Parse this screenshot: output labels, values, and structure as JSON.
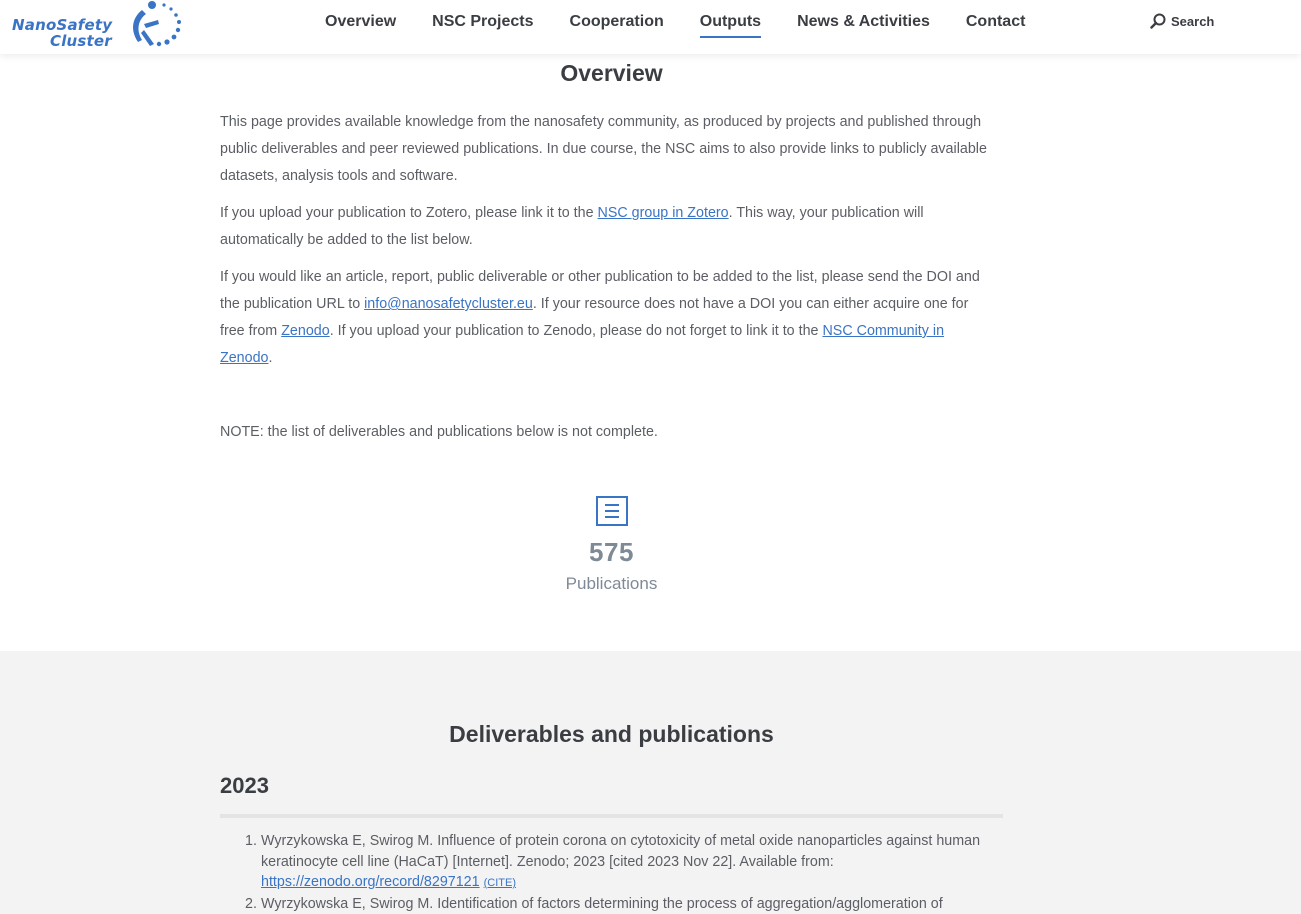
{
  "brand": {
    "line1": "NanoSafety",
    "line2": "Cluster",
    "color": "#3a74c4"
  },
  "nav": {
    "items": [
      "Overview",
      "NSC Projects",
      "Cooperation",
      "Outputs",
      "News & Activities",
      "Contact"
    ],
    "active": "Outputs"
  },
  "search": {
    "label": "Search",
    "icon": "search-icon"
  },
  "page": {
    "title": "Overview",
    "p1": "This page provides available knowledge from the nanosafety community, as produced by projects and published through public deliverables and peer reviewed publications. In due course, the NSC aims to also provide links to publicly available datasets, analysis tools and software.",
    "p2_before": "If you upload your publication to Zotero, please link it to the ",
    "p2_link": "NSC group in Zotero",
    "p2_after": ". This way, your publication will automatically be added to the list below.",
    "p3_a": "If you would like an article, report, public deliverable or other publication to be added to the list, please send the DOI and the publication URL to ",
    "p3_email": "info@nanosafetycluster.eu",
    "p3_b": ". If your resource does not have a DOI you can either acquire one for free from ",
    "p3_zenodo": "Zenodo",
    "p3_c": ". If you upload your publication to Zenodo, please do not forget to link it to the ",
    "p3_community": "NSC Community in Zenodo",
    "p3_d": ".",
    "note": "NOTE: the list of deliverables and publications below is not complete."
  },
  "stats": {
    "icon": "document-list-icon",
    "count": "575",
    "label": "Publications"
  },
  "publications": {
    "title": "Deliverables and publications",
    "year": "2023",
    "items": [
      {
        "num": "1.",
        "text": "Wyrzykowska E, Swirog M. Influence of protein corona on cytotoxicity of metal oxide nanoparticles against human keratinocyte cell line (HaCaT) [Internet]. Zenodo; 2023 [cited 2023 Nov 22]. Available from: ",
        "link": "https://zenodo.org/record/8297121",
        "cite": "(CITE)"
      },
      {
        "num": "2.",
        "text": "Wyrzykowska E, Swirog M. Identification of factors determining the process of aggregation/agglomeration of",
        "link": "",
        "cite": ""
      }
    ]
  },
  "colors": {
    "accent": "#3a74c4",
    "heading": "#3a3d42",
    "body": "#5b5e64",
    "stat": "#7f8a97",
    "section_bg": "#f3f3f3"
  }
}
